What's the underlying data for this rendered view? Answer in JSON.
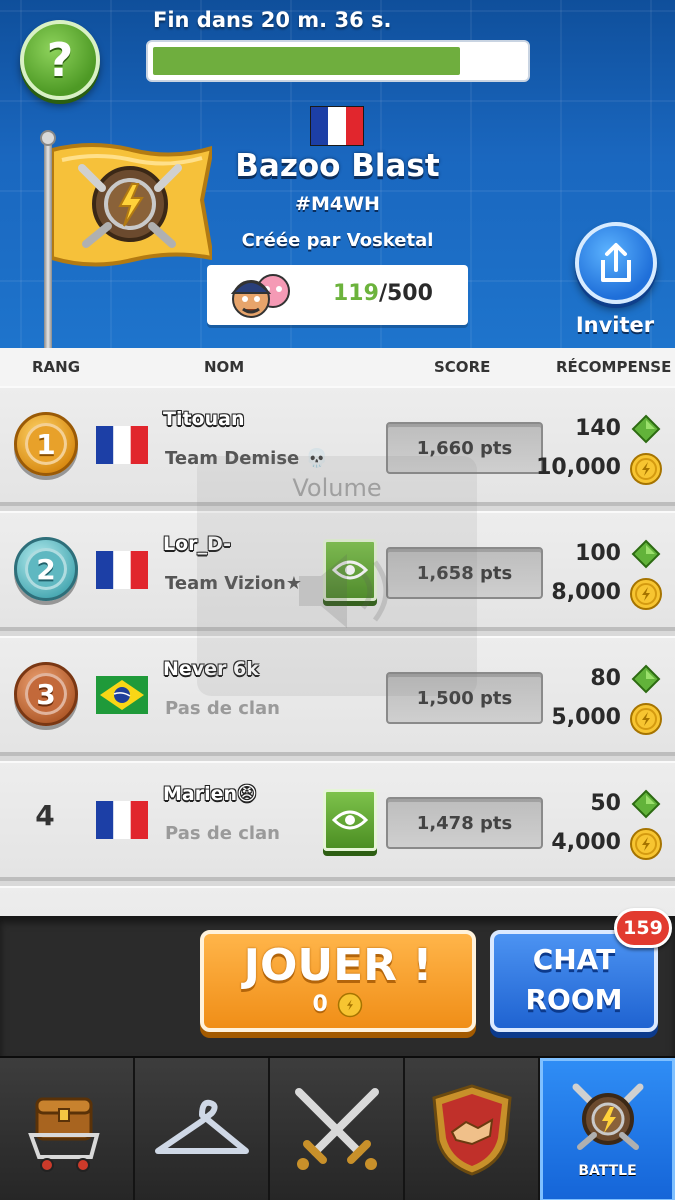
{
  "header": {
    "timer": "Fin dans 20 m. 36 s.",
    "progress_fraction": 0.83,
    "help_label": "?",
    "clan_name": "Bazoo Blast",
    "clan_tag": "#M4WH",
    "creator": "Créée par Vosketal",
    "members_current": "119",
    "members_max": "/500",
    "invite_label": "Inviter",
    "flag_country": "France"
  },
  "columns": {
    "rank": "RANG",
    "name": "NOM",
    "score": "SCORE",
    "reward": "RÉCOMPENSE"
  },
  "rows": [
    {
      "rank": "1",
      "medal": "gold",
      "flag": "France",
      "name": "Titouan",
      "clan": "Team Demise 💀",
      "score": "1,660 pts",
      "gems": "140",
      "coins": "10,000",
      "spectate": false
    },
    {
      "rank": "2",
      "medal": "silver",
      "flag": "France",
      "name": "Lor_D-",
      "clan": "Team Vizion★",
      "score": "1,658 pts",
      "gems": "100",
      "coins": "8,000",
      "spectate": true
    },
    {
      "rank": "3",
      "medal": "bronze",
      "flag": "Brazil",
      "name": "Never 6k",
      "clan": "Pas de clan",
      "score": "1,500 pts",
      "gems": "80",
      "coins": "5,000",
      "spectate": false
    },
    {
      "rank": "4",
      "medal": "none",
      "flag": "France",
      "name": "Marien😠",
      "clan": "Pas de clan",
      "score": "1,478 pts",
      "gems": "50",
      "coins": "4,000",
      "spectate": true
    }
  ],
  "overlay": {
    "volume_label": "Volume"
  },
  "actions": {
    "play_label": "JOUER !",
    "play_cost": "0",
    "chat_label_1": "CHAT",
    "chat_label_2": "ROOM",
    "chat_badge": "159"
  },
  "nav": {
    "items": [
      {
        "icon": "shop-cart-icon"
      },
      {
        "icon": "hanger-icon"
      },
      {
        "icon": "crossed-swords-icon"
      },
      {
        "icon": "clan-shield-icon"
      },
      {
        "icon": "battle-emblem-icon",
        "label": "BATTLE",
        "active": true
      }
    ]
  },
  "colors": {
    "header_blue": "#1a67bf",
    "green_accent": "#6fae3e",
    "play_orange": "#f08e17",
    "chat_blue": "#1f63d1",
    "badge_red": "#e23b2f"
  }
}
